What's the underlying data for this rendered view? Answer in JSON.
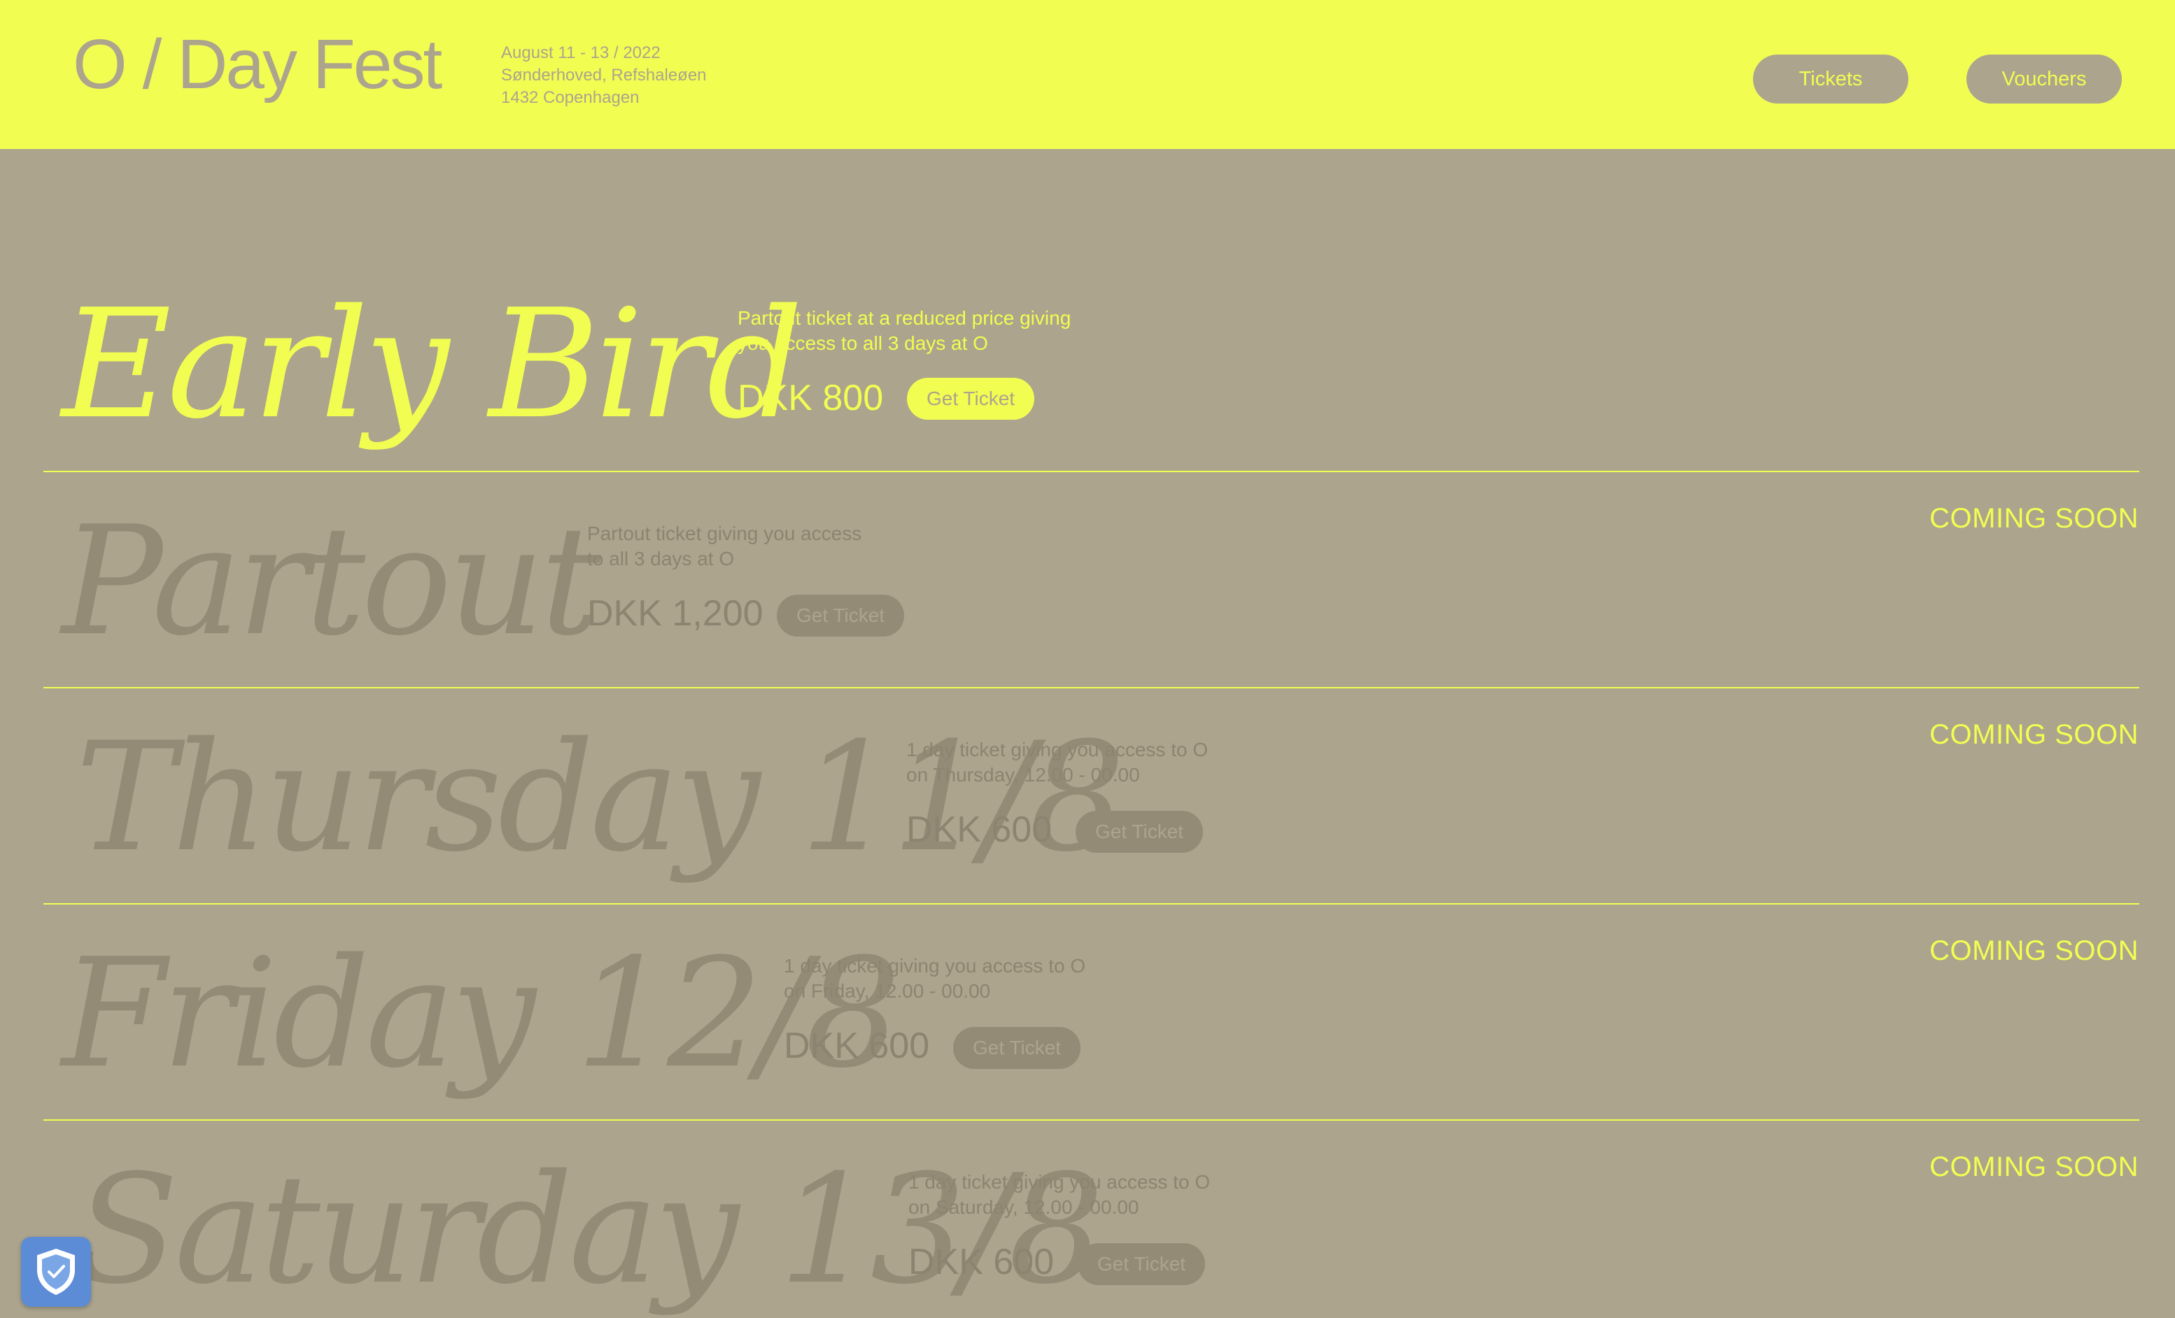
{
  "header": {
    "logo": "O / Day Fest",
    "event_lines": [
      "August 11 - 13 / 2022",
      "Sønderhoved, Refshaleøen",
      "1432 Copenhagen"
    ],
    "nav": {
      "tickets_label": "Tickets",
      "vouchers_label": "Vouchers"
    }
  },
  "tickets": [
    {
      "title": "Early Bird",
      "desc_lines": [
        "Partout ticket at a reduced price giving",
        "you access to all 3 days at O"
      ],
      "price": "DKK 800",
      "button": "Get Ticket",
      "status": ""
    },
    {
      "title": "Partout",
      "desc_lines": [
        "Partout ticket giving you access",
        "to all 3 days at O"
      ],
      "price": "DKK 1,200",
      "button": "Get Ticket",
      "status": "COMING SOON"
    },
    {
      "title": "Thursday 11/8",
      "desc_lines": [
        "1 day ticket giving you access to O",
        "on Thursday, 12.00 - 00.00"
      ],
      "price": "DKK 600",
      "button": "Get Ticket",
      "status": "COMING SOON"
    },
    {
      "title": "Friday 12/8",
      "desc_lines": [
        "1 day ticket giving you access to O",
        "on Friday, 12.00 - 00.00"
      ],
      "price": "DKK 600",
      "button": "Get Ticket",
      "status": "COMING SOON"
    },
    {
      "title": "Saturday 13/8",
      "desc_lines": [
        "1 day ticket giving you access to O",
        "on Saturday, 12.00 - 00.00"
      ],
      "price": "DKK 600",
      "button": "Get Ticket",
      "status": "COMING SOON"
    }
  ],
  "colors": {
    "accent_yellow": "#f2fd52",
    "background_khaki": "#aca48c",
    "muted_text": "#8c8470",
    "badge_blue": "#5d8cd6"
  },
  "icons": {
    "privacy_badge": "shield-check-icon"
  }
}
